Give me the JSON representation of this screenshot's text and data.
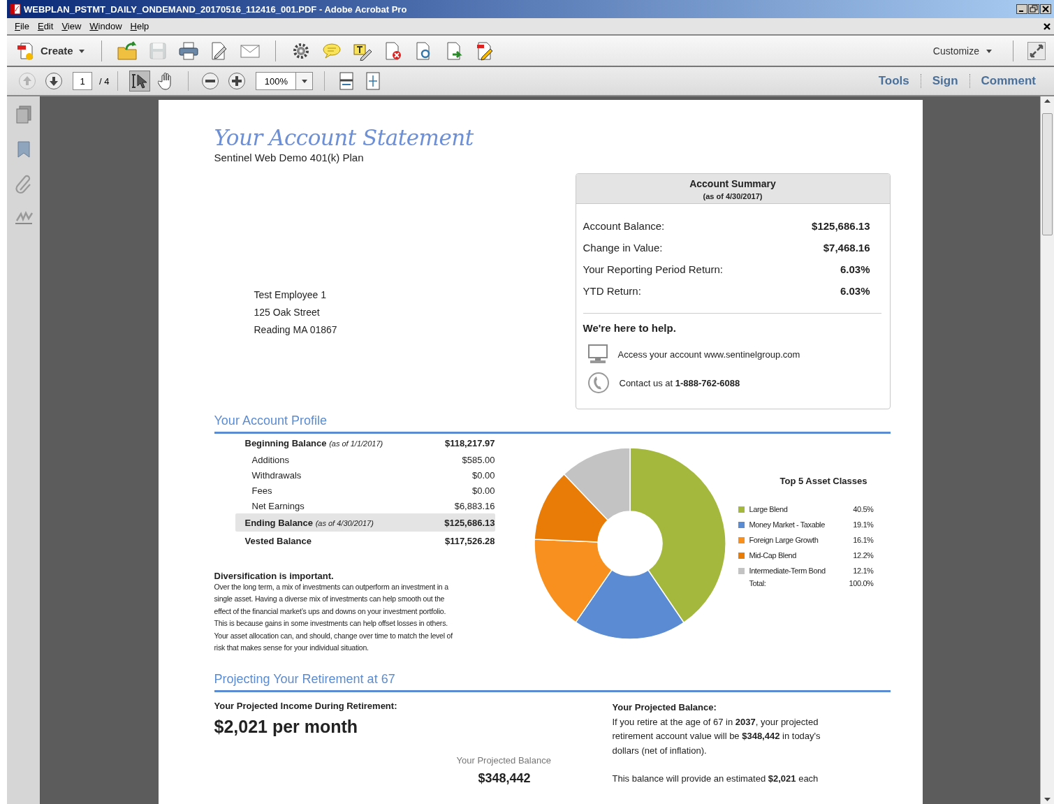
{
  "window": {
    "title": "WEBPLAN_PSTMT_DAILY_ONDEMAND_20170516_112416_001.PDF - Adobe Acrobat Pro"
  },
  "menu": [
    {
      "label": "File"
    },
    {
      "label": "Edit"
    },
    {
      "label": "View"
    },
    {
      "label": "Window"
    },
    {
      "label": "Help"
    }
  ],
  "toolbar": {
    "create": "Create",
    "save_disabled": true,
    "customize": "Customize"
  },
  "navigation": {
    "previous_disabled": true,
    "page": "1",
    "page_count": "/ 4",
    "zoom": "100%",
    "select_tool_selected": true
  },
  "task_panes": [
    {
      "label": "Tools"
    },
    {
      "label": "Sign"
    },
    {
      "label": "Comment"
    }
  ],
  "document": {
    "title": "Your Account Statement",
    "plan": "Sentinel Web Demo 401(k) Plan",
    "address": [
      "Test Employee 1",
      "125 Oak Street",
      "Reading MA 01867"
    ],
    "summary": {
      "title": "Account Summary",
      "as_of": "(as of 4/30/2017)",
      "rows": [
        {
          "label": "Account Balance:",
          "value": "$125,686.13"
        },
        {
          "label": "Change in Value:",
          "value": "$7,468.16"
        },
        {
          "label": "Your Reporting Period Return:",
          "value": "6.03%"
        },
        {
          "label": "YTD Return:",
          "value": "6.03%"
        }
      ],
      "help_heading": "We're here to help.",
      "contacts": [
        {
          "kind": "web",
          "text": "Access your account www.sentinelgroup.com"
        },
        {
          "kind": "phone",
          "text": "Contact us at **1-888-762-6088**"
        }
      ]
    },
    "profile": {
      "heading": "Your Account Profile",
      "rows": [
        {
          "kind": "total",
          "label": "Beginning Balance",
          "note": "(as of 1/1/2017)",
          "value": "$118,217.97",
          "highlighted": false
        },
        {
          "kind": "detail",
          "label": "Additions",
          "value": "$585.00",
          "highlighted": false
        },
        {
          "kind": "detail",
          "label": "Withdrawals",
          "value": "$0.00",
          "highlighted": false
        },
        {
          "kind": "detail",
          "label": "Fees",
          "value": "$0.00",
          "highlighted": false
        },
        {
          "kind": "detail",
          "label": "Net Earnings",
          "value": "$6,883.16",
          "highlighted": false
        },
        {
          "kind": "total",
          "label": "Ending Balance",
          "note": "(as of 4/30/2017)",
          "value": "$125,686.13",
          "highlighted": true
        },
        {
          "kind": "total",
          "label": "Vested Balance",
          "value": "$117,526.28",
          "highlighted": false
        }
      ]
    },
    "diversification": {
      "heading": "Diversification is important.",
      "body": "Over the long term, a mix of investments can outperform an investment in a single asset. Having a diverse mix of investments can help smooth out the effect of the financial market’s ups and downs on your investment portfolio. This is because gains in some investments can help offset losses in others. Your asset allocation can, and should, change over time to match the level of risk that makes sense for your individual situation."
    },
    "allocation": {
      "chart_data": {
        "type": "donut",
        "title": "Top 5 Asset Classes",
        "categories": [
          "Large Blend",
          "Money Market - Taxable",
          "Foreign Large Growth",
          "Mid-Cap Blend",
          "Intermediate-Term Bond"
        ],
        "values": [
          40.5,
          19.1,
          16.1,
          12.2,
          12.1
        ]
      },
      "legend": [
        {
          "share": "40.5%",
          "color": "#a4b83e"
        },
        {
          "share": "19.1%",
          "color": "#5b8bd3"
        },
        {
          "share": "16.1%",
          "color": "#f8901f"
        },
        {
          "share": "12.2%",
          "color": "#e87c06"
        },
        {
          "share": "12.1%",
          "color": "#c3c3c3"
        }
      ],
      "total_label": "Total:",
      "total": "100.0%"
    },
    "retirement": {
      "heading": "Projecting Your Retirement at 67",
      "income_label": "Your Projected Income During Retirement:",
      "income": "$2,021 per month",
      "balance_caption": "Your Projected Balance",
      "balance": "$348,442",
      "details_heading": "Your Projected Balance:",
      "paragraphs": [
        "If you retire at the age of 67 in **2037**, your projected retirement account value will be **$348,442** in today's dollars (net of inflation).",
        "This balance will provide an estimated **$2,021** each"
      ]
    }
  }
}
